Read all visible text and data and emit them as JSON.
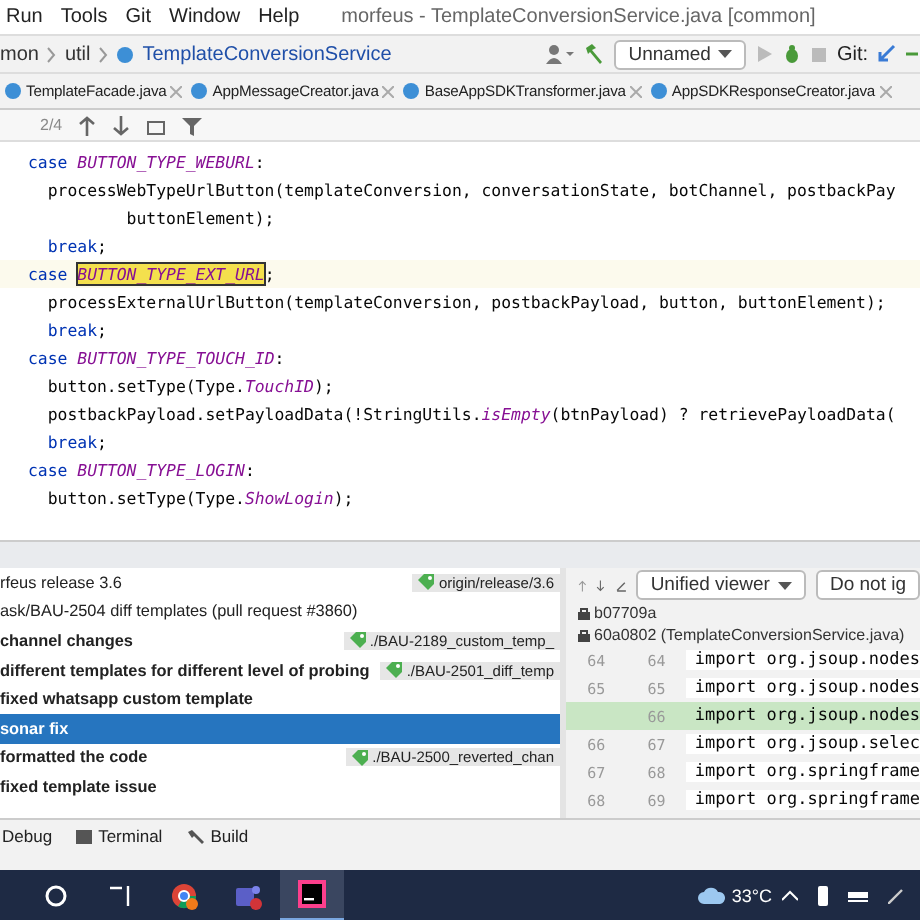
{
  "menu": [
    "Run",
    "Tools",
    "Git",
    "Window",
    "Help"
  ],
  "window": {
    "title": "morfeus - TemplateConversionService.java [common]"
  },
  "breadcrumbs": [
    "mon",
    "util",
    "TemplateConversionService"
  ],
  "run_config": {
    "label": "Unnamed"
  },
  "git_label": "Git:",
  "tabs": [
    "TemplateFacade.java",
    "AppMessageCreator.java",
    "BaseAppSDKTransformer.java",
    "AppSDKResponseCreator.java"
  ],
  "find": {
    "count": "2/4"
  },
  "code": [
    {
      "current": false,
      "tokens": [
        {
          "kind": "kw",
          "text": "case "
        },
        {
          "kind": "const",
          "text": "BUTTON_TYPE_WEBURL"
        },
        {
          "kind": "plain",
          "text": ":"
        }
      ]
    },
    {
      "current": false,
      "tokens": [
        {
          "kind": "plain",
          "text": "  processWebTypeUrlButton(templateConversion, conversationState, botChannel, postbackPay"
        }
      ]
    },
    {
      "current": false,
      "tokens": [
        {
          "kind": "plain",
          "text": "          buttonElement);"
        }
      ]
    },
    {
      "current": false,
      "tokens": [
        {
          "kind": "kw",
          "text": "  break"
        },
        {
          "kind": "plain",
          "text": ";"
        }
      ]
    },
    {
      "current": true,
      "tokens": [
        {
          "kind": "kw",
          "text": "case "
        },
        {
          "kind": "match",
          "text": "BUTTON_TYPE_EXT_URL"
        },
        {
          "kind": "plain",
          "text": ";"
        }
      ]
    },
    {
      "current": false,
      "tokens": [
        {
          "kind": "plain",
          "text": "  processExternalUrlButton(templateConversion, postbackPayload, button, buttonElement);"
        }
      ]
    },
    {
      "current": false,
      "tokens": [
        {
          "kind": "kw",
          "text": "  break"
        },
        {
          "kind": "plain",
          "text": ";"
        }
      ]
    },
    {
      "current": false,
      "tokens": [
        {
          "kind": "kw",
          "text": "case "
        },
        {
          "kind": "const",
          "text": "BUTTON_TYPE_TOUCH_ID"
        },
        {
          "kind": "plain",
          "text": ":"
        }
      ]
    },
    {
      "current": false,
      "tokens": [
        {
          "kind": "plain",
          "text": "  button.setType(Type."
        },
        {
          "kind": "const",
          "text": "TouchID"
        },
        {
          "kind": "plain",
          "text": ");"
        }
      ]
    },
    {
      "current": false,
      "tokens": [
        {
          "kind": "plain",
          "text": "  postbackPayload.setPayloadData(!StringUtils."
        },
        {
          "kind": "const",
          "text": "isEmpty"
        },
        {
          "kind": "plain",
          "text": "(btnPayload) ? retrievePayloadData("
        }
      ]
    },
    {
      "current": false,
      "tokens": [
        {
          "kind": "kw",
          "text": "  break"
        },
        {
          "kind": "plain",
          "text": ";"
        }
      ]
    },
    {
      "current": false,
      "tokens": [
        {
          "kind": "kw",
          "text": "case "
        },
        {
          "kind": "const",
          "text": "BUTTON_TYPE_LOGIN"
        },
        {
          "kind": "plain",
          "text": ":"
        }
      ]
    },
    {
      "current": false,
      "tokens": [
        {
          "kind": "plain",
          "text": "  button.setType(Type."
        },
        {
          "kind": "const",
          "text": "ShowLogin"
        },
        {
          "kind": "plain",
          "text": ");"
        }
      ]
    }
  ],
  "commits": [
    {
      "message": "rfeus release 3.6",
      "bold": false,
      "selected": false,
      "tag": "origin/release/3.6"
    },
    {
      "message": "ask/BAU-2504 diff templates (pull request #3860)",
      "bold": false,
      "selected": false
    },
    {
      "message": "channel changes",
      "bold": true,
      "selected": false,
      "tag": "./BAU-2189_custom_temp_"
    },
    {
      "message": "different templates for different level of probing",
      "bold": true,
      "selected": false,
      "tag": "./BAU-2501_diff_temp"
    },
    {
      "message": "fixed whatsapp custom template",
      "bold": true,
      "selected": false
    },
    {
      "message": "sonar fix",
      "bold": true,
      "selected": true
    },
    {
      "message": "formatted the code",
      "bold": true,
      "selected": false,
      "tag": "./BAU-2500_reverted_chan"
    },
    {
      "message": "fixed template issue",
      "bold": true,
      "selected": false
    }
  ],
  "diff": {
    "viewer": "Unified viewer",
    "ignore": "Do not ig",
    "revisions": [
      "b07709a",
      "60a0802 (TemplateConversionService.java)"
    ],
    "lines": [
      {
        "kind": "context",
        "old": "64",
        "new": "64",
        "text": "import org.jsoup.nodes"
      },
      {
        "kind": "context",
        "old": "65",
        "new": "65",
        "text": "import org.jsoup.nodes"
      },
      {
        "kind": "added",
        "new": "66",
        "text": "import org.jsoup.nodes"
      },
      {
        "kind": "context",
        "old": "66",
        "new": "67",
        "text": "import org.jsoup.selec"
      },
      {
        "kind": "context",
        "old": "67",
        "new": "68",
        "text": "import org.springframe"
      },
      {
        "kind": "context",
        "old": "68",
        "new": "69",
        "text": "import org.springframe"
      }
    ]
  },
  "tool_windows": [
    "Debug",
    "Terminal",
    "Build"
  ],
  "taskbar": {
    "apps": [
      {
        "kind": "search",
        "active": false
      },
      {
        "kind": "taskview",
        "active": false
      },
      {
        "kind": "browser",
        "active": false
      },
      {
        "kind": "chat",
        "active": false
      },
      {
        "kind": "ide",
        "active": true
      }
    ],
    "temperature": "33°C"
  }
}
